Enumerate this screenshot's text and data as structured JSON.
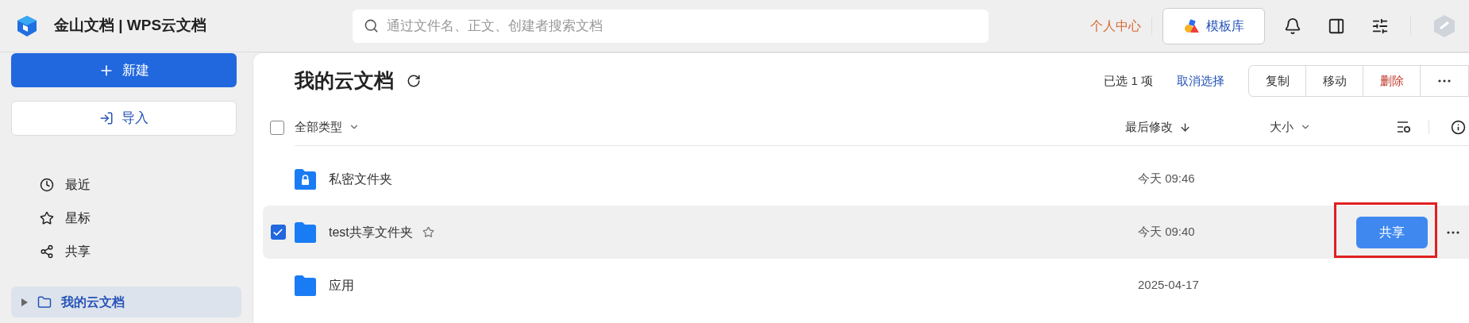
{
  "app": {
    "title": "金山文档 | WPS云文档"
  },
  "search": {
    "placeholder": "通过文件名、正文、创建者搜索文档"
  },
  "topbar": {
    "personal_center": "个人中心",
    "template_button": "模板库"
  },
  "sidebar": {
    "new_button": "新建",
    "import_button": "导入",
    "nav": [
      {
        "label": "最近",
        "kind": "recent",
        "selected": false
      },
      {
        "label": "星标",
        "kind": "star",
        "selected": false
      },
      {
        "label": "共享",
        "kind": "share",
        "selected": false
      }
    ],
    "tree": [
      {
        "label": "我的云文档",
        "selected": true,
        "expanded": false
      }
    ]
  },
  "main": {
    "title": "我的云文档",
    "selection_count": "已选 1 项",
    "cancel_selection": "取消选择",
    "actions": [
      {
        "label": "复制",
        "kind": "normal"
      },
      {
        "label": "移动",
        "kind": "normal"
      },
      {
        "label": "删除",
        "kind": "danger"
      }
    ],
    "columns": {
      "name": "全部类型",
      "modified": "最后修改",
      "size": "大小"
    },
    "select_all": {
      "checked": false
    },
    "rows": [
      {
        "name": "私密文件夹",
        "kind": "private",
        "modified": "今天 09:46",
        "checked": false,
        "selected": false
      },
      {
        "name": "test共享文件夹",
        "kind": "folder",
        "modified": "今天 09:40",
        "checked": true,
        "selected": true,
        "starred": false,
        "share_button": "共享",
        "highlighted": true
      },
      {
        "name": "应用",
        "kind": "folder",
        "modified": "2025-04-17",
        "checked": false,
        "selected": false
      }
    ]
  }
}
